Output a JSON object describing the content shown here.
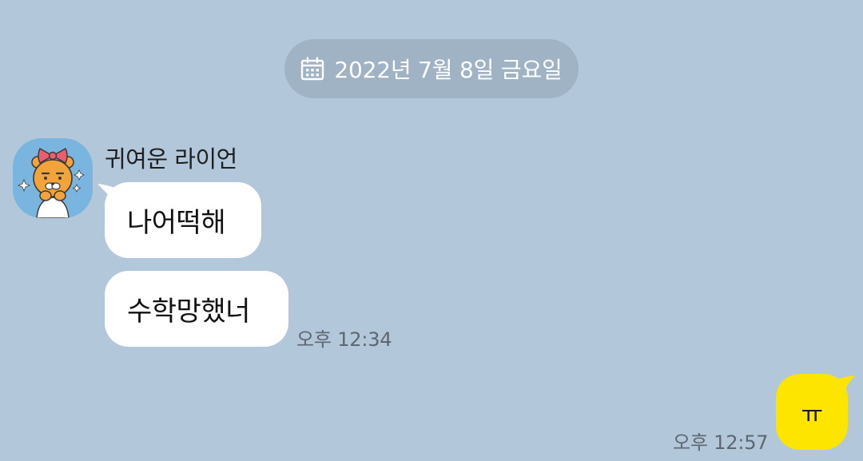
{
  "date_divider": {
    "icon": "calendar-icon",
    "text": "2022년 7월 8일 금요일"
  },
  "received": {
    "sender_name": "귀여운 라이언",
    "avatar_icon": "ryan-avatar",
    "messages": [
      "나어떡해",
      "수학망했너"
    ],
    "time": "오후 12:34"
  },
  "sent": {
    "message": "ㅠ",
    "time": "오후 12:57"
  },
  "colors": {
    "background": "#b2c7da",
    "received_bubble": "#ffffff",
    "sent_bubble": "#fee500",
    "date_pill": "#9fb3c5"
  }
}
